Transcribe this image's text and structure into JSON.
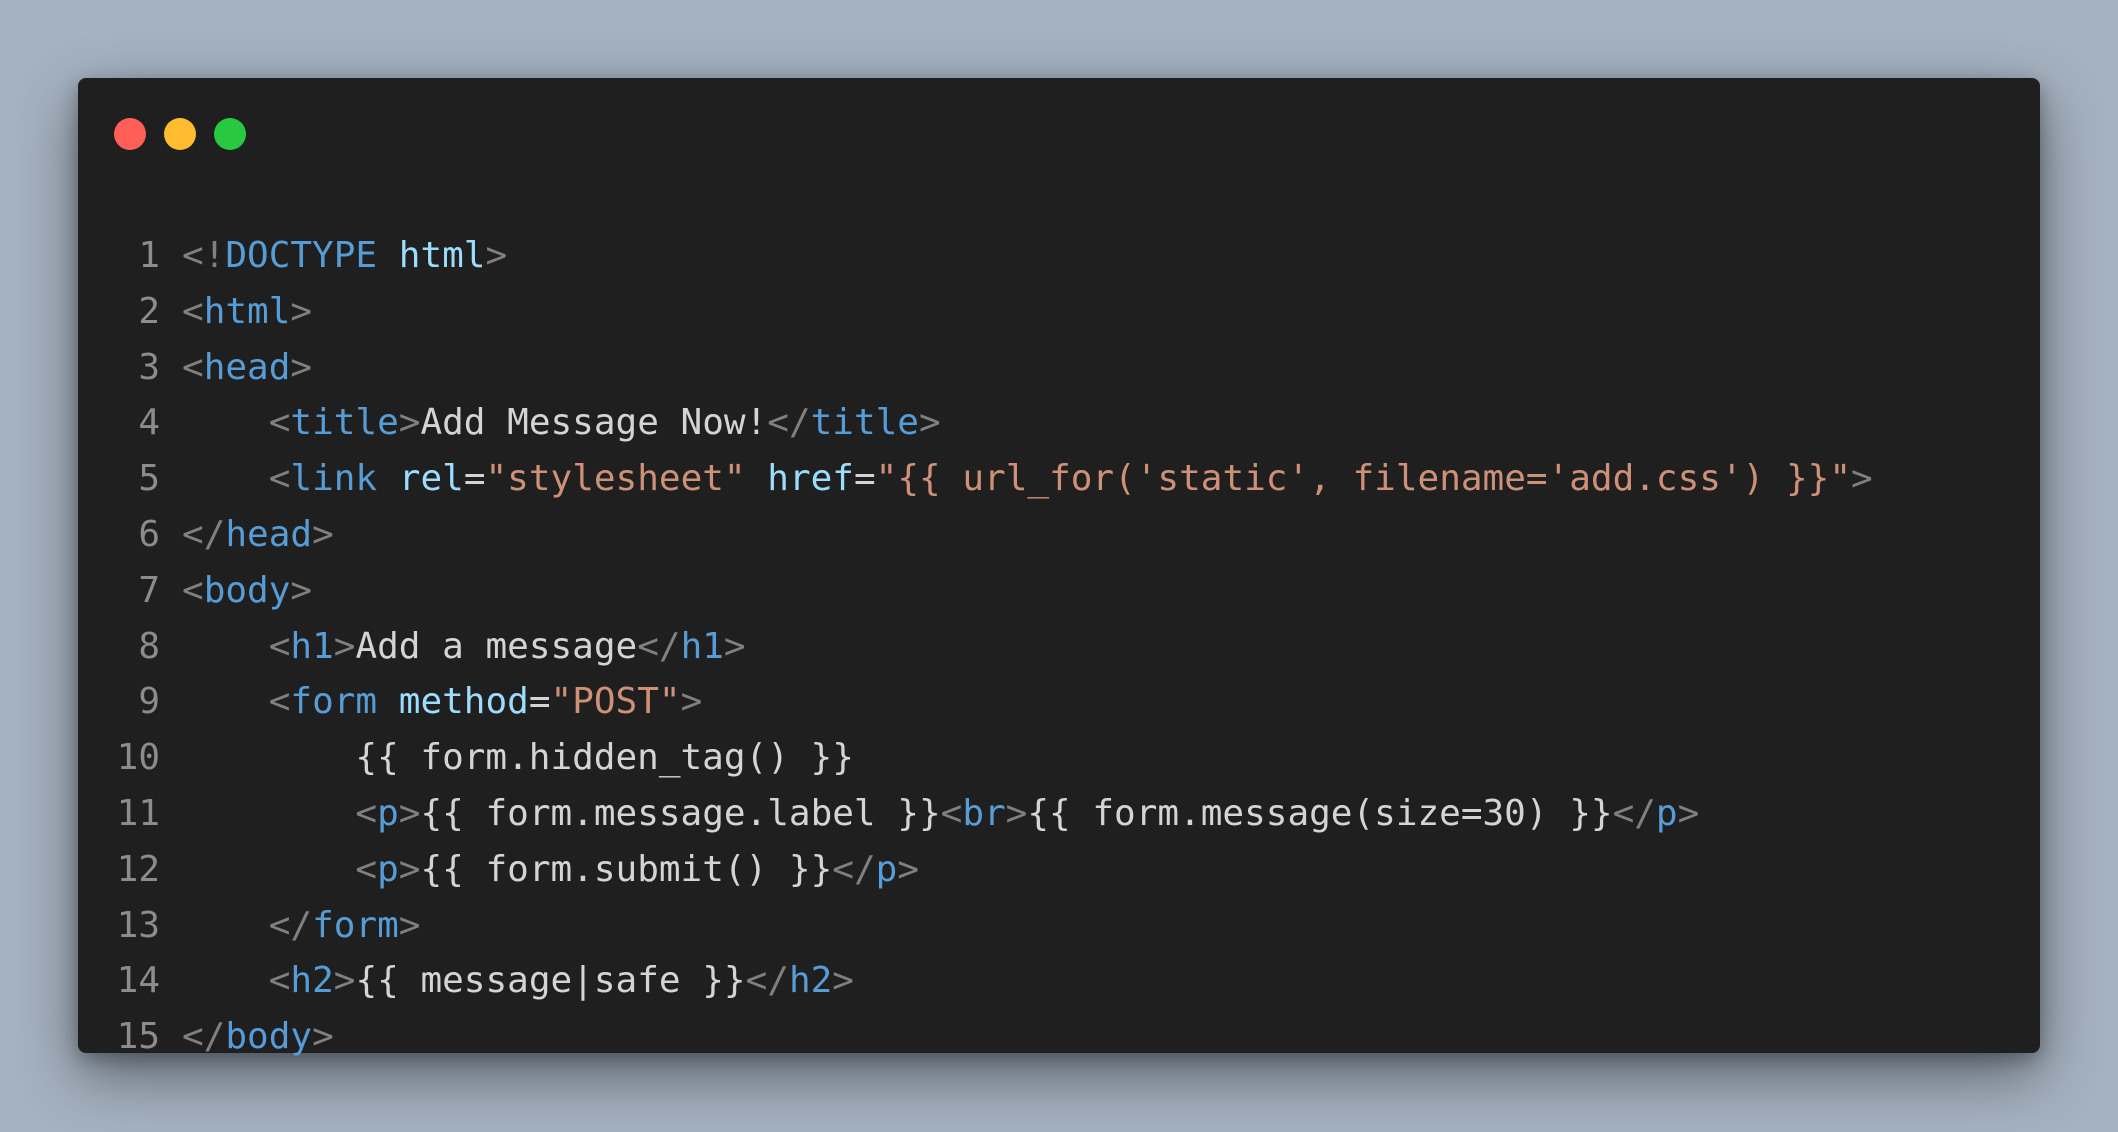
{
  "window": {
    "controls": [
      "close-button",
      "minimize-button",
      "maximize-button"
    ],
    "colors": {
      "background": "#1f1f1f",
      "close": "#ff5f57",
      "minimize": "#febc2e",
      "maximize": "#28c840"
    }
  },
  "editor": {
    "language": "html",
    "theme_colors": {
      "punctuation": "#808080",
      "tag": "#569cd6",
      "attribute": "#9cdcfe",
      "string": "#ce9178",
      "text": "#d4d4d4",
      "line_number": "#8c8c8c"
    },
    "lines": [
      {
        "n": "1",
        "tokens": [
          [
            "p",
            "<!"
          ],
          [
            "k",
            "DOCTYPE"
          ],
          [
            "t",
            " "
          ],
          [
            "a",
            "html"
          ],
          [
            "p",
            ">"
          ]
        ]
      },
      {
        "n": "2",
        "tokens": [
          [
            "p",
            "<"
          ],
          [
            "k",
            "html"
          ],
          [
            "p",
            ">"
          ]
        ]
      },
      {
        "n": "3",
        "tokens": [
          [
            "p",
            "<"
          ],
          [
            "k",
            "head"
          ],
          [
            "p",
            ">"
          ]
        ]
      },
      {
        "n": "4",
        "tokens": [
          [
            "t",
            "    "
          ],
          [
            "p",
            "<"
          ],
          [
            "k",
            "title"
          ],
          [
            "p",
            ">"
          ],
          [
            "t",
            "Add Message Now!"
          ],
          [
            "p",
            "</"
          ],
          [
            "k",
            "title"
          ],
          [
            "p",
            ">"
          ]
        ]
      },
      {
        "n": "5",
        "tokens": [
          [
            "t",
            "    "
          ],
          [
            "p",
            "<"
          ],
          [
            "k",
            "link"
          ],
          [
            "t",
            " "
          ],
          [
            "a",
            "rel"
          ],
          [
            "t",
            "="
          ],
          [
            "s",
            "\"stylesheet\""
          ],
          [
            "t",
            " "
          ],
          [
            "a",
            "href"
          ],
          [
            "t",
            "="
          ],
          [
            "s",
            "\"{{ url_for('static', filename='add.css') }}\""
          ],
          [
            "p",
            ">"
          ]
        ]
      },
      {
        "n": "6",
        "tokens": [
          [
            "p",
            "</"
          ],
          [
            "k",
            "head"
          ],
          [
            "p",
            ">"
          ]
        ]
      },
      {
        "n": "7",
        "tokens": [
          [
            "p",
            "<"
          ],
          [
            "k",
            "body"
          ],
          [
            "p",
            ">"
          ]
        ]
      },
      {
        "n": "8",
        "tokens": [
          [
            "t",
            "    "
          ],
          [
            "p",
            "<"
          ],
          [
            "k",
            "h1"
          ],
          [
            "p",
            ">"
          ],
          [
            "t",
            "Add a message"
          ],
          [
            "p",
            "</"
          ],
          [
            "k",
            "h1"
          ],
          [
            "p",
            ">"
          ]
        ]
      },
      {
        "n": "9",
        "tokens": [
          [
            "t",
            "    "
          ],
          [
            "p",
            "<"
          ],
          [
            "k",
            "form"
          ],
          [
            "t",
            " "
          ],
          [
            "a",
            "method"
          ],
          [
            "t",
            "="
          ],
          [
            "s",
            "\"POST\""
          ],
          [
            "p",
            ">"
          ]
        ]
      },
      {
        "n": "10",
        "tokens": [
          [
            "t",
            "        {{ form.hidden_tag() }}"
          ]
        ]
      },
      {
        "n": "11",
        "tokens": [
          [
            "t",
            "        "
          ],
          [
            "p",
            "<"
          ],
          [
            "k",
            "p"
          ],
          [
            "p",
            ">"
          ],
          [
            "t",
            "{{ form.message.label }}"
          ],
          [
            "p",
            "<"
          ],
          [
            "k",
            "br"
          ],
          [
            "p",
            ">"
          ],
          [
            "t",
            "{{ form.message(size=30) }}"
          ],
          [
            "p",
            "</"
          ],
          [
            "k",
            "p"
          ],
          [
            "p",
            ">"
          ]
        ]
      },
      {
        "n": "12",
        "tokens": [
          [
            "t",
            "        "
          ],
          [
            "p",
            "<"
          ],
          [
            "k",
            "p"
          ],
          [
            "p",
            ">"
          ],
          [
            "t",
            "{{ form.submit() }}"
          ],
          [
            "p",
            "</"
          ],
          [
            "k",
            "p"
          ],
          [
            "p",
            ">"
          ]
        ]
      },
      {
        "n": "13",
        "tokens": [
          [
            "t",
            "    "
          ],
          [
            "p",
            "</"
          ],
          [
            "k",
            "form"
          ],
          [
            "p",
            ">"
          ]
        ]
      },
      {
        "n": "14",
        "tokens": [
          [
            "t",
            "    "
          ],
          [
            "p",
            "<"
          ],
          [
            "k",
            "h2"
          ],
          [
            "p",
            ">"
          ],
          [
            "t",
            "{{ message|safe }}"
          ],
          [
            "p",
            "</"
          ],
          [
            "k",
            "h2"
          ],
          [
            "p",
            ">"
          ]
        ]
      },
      {
        "n": "15",
        "tokens": [
          [
            "p",
            "</"
          ],
          [
            "k",
            "body"
          ],
          [
            "p",
            ">"
          ]
        ]
      }
    ]
  }
}
